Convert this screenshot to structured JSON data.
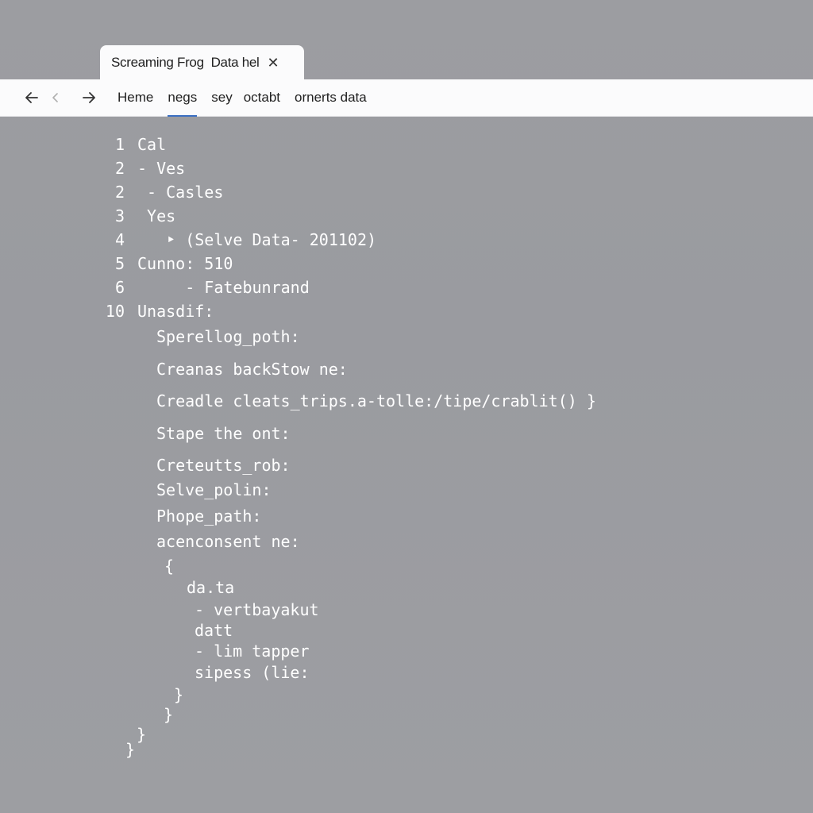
{
  "tab": {
    "title": "Screaming Frog  Data hel",
    "close_glyph": "✕"
  },
  "toolbar": {
    "menu": [
      "Heme",
      "negs",
      "sey",
      "octabt",
      "ornerts data"
    ],
    "active_index": 1
  },
  "code": {
    "numbered": [
      {
        "num": "1",
        "text": "Cal"
      },
      {
        "num": "2",
        "text": "- Ves"
      },
      {
        "num": "2",
        "text": " - Casles"
      },
      {
        "num": "3",
        "text": " Yes"
      },
      {
        "num": "4",
        "text": "   ‣ (Selve Data- 201102)"
      },
      {
        "num": "5",
        "text": "Cunno: 510"
      },
      {
        "num": "6",
        "text": "     - Fatebunrand"
      },
      {
        "num": "10",
        "text": "Unasdif:"
      }
    ],
    "body": [
      "Sperellog_poth:",
      "Creanas backStow ne:",
      "Creadle cleats_trips.a-tolle:/tipe/crablit() }",
      "Stape the ont:",
      "Creteutts_rob:",
      "Selve_polin:",
      "Phope_path:",
      "acenconsent ne:",
      "{",
      "da.ta",
      "- vertbayakut",
      "datt",
      "- lim tapper",
      "sipess (lie:",
      "}",
      "}",
      "}",
      "}"
    ]
  }
}
